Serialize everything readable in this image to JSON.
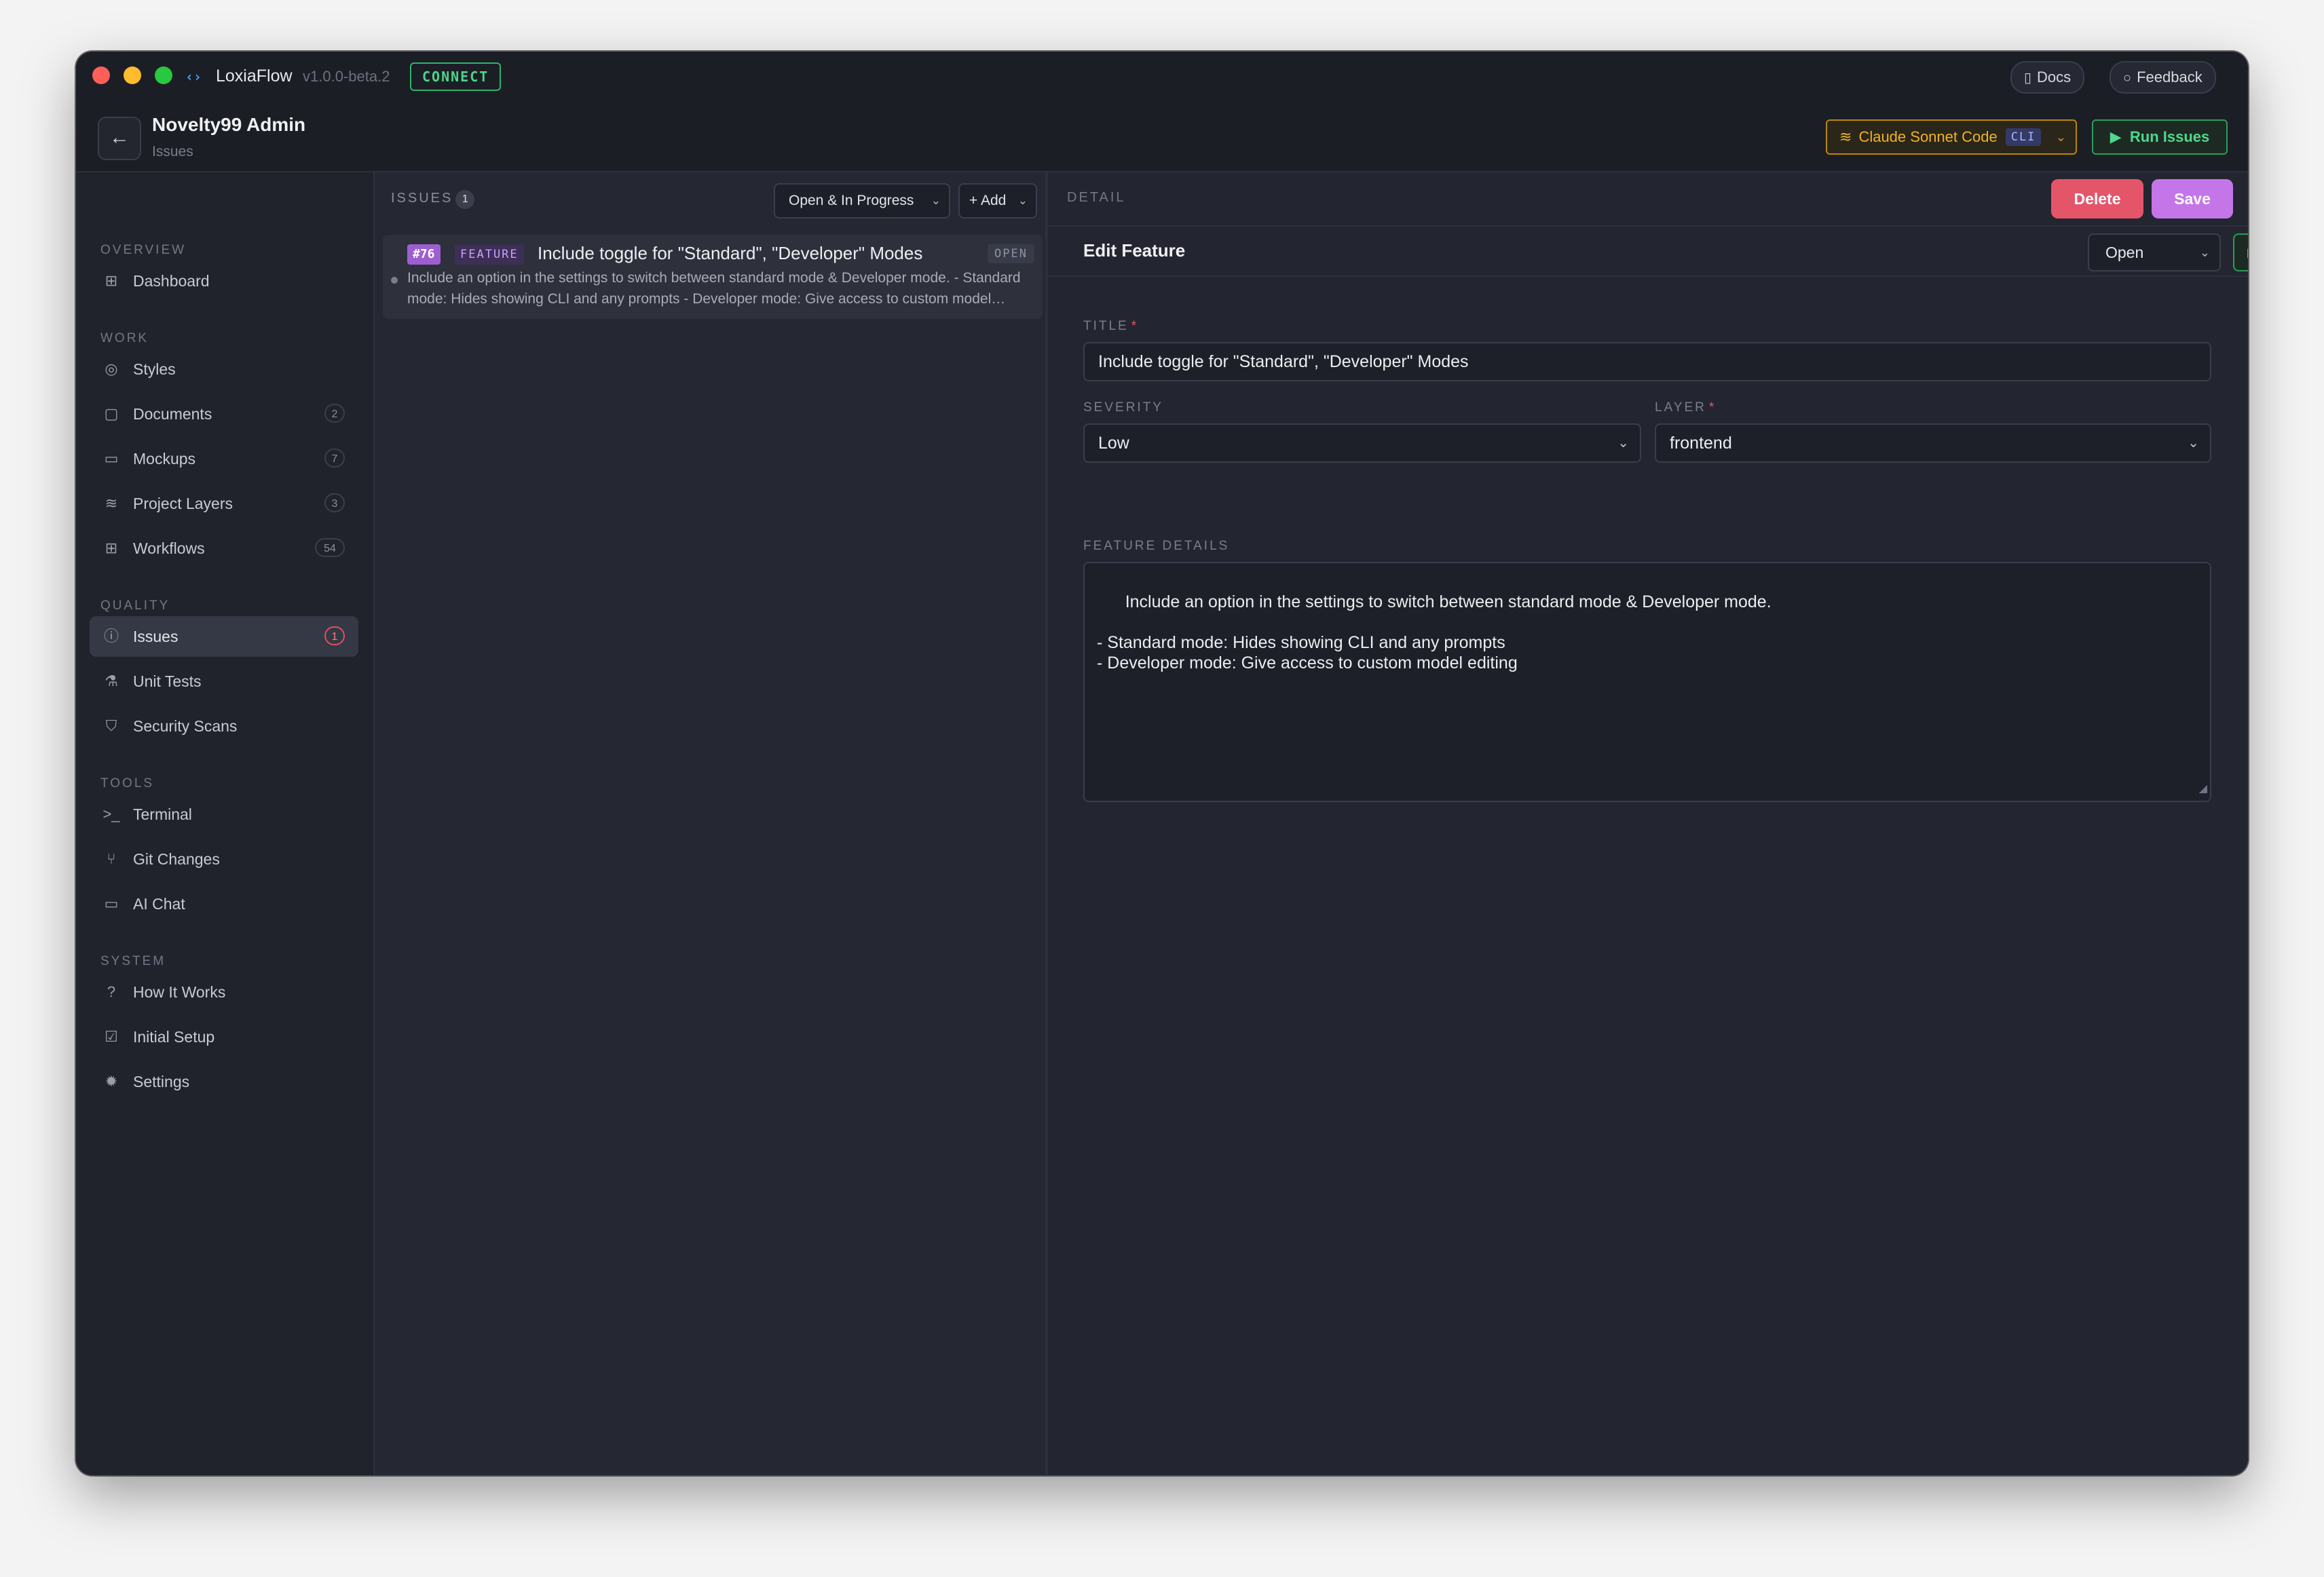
{
  "app": {
    "name": "LoxiaFlow",
    "version": "v1.0.0-beta.2",
    "connect_label": "CONNECT",
    "docs_label": "Docs",
    "feedback_label": "Feedback"
  },
  "project": {
    "name": "Novelty99 Admin",
    "subtitle": "Issues"
  },
  "toolbar": {
    "model_label": "Claude Sonnet Code",
    "model_tag": "CLI",
    "run_label": "Run Issues"
  },
  "sidebar": {
    "sections": {
      "overview": "OVERVIEW",
      "work": "WORK",
      "quality": "QUALITY",
      "tools": "TOOLS",
      "system": "SYSTEM"
    },
    "items": {
      "dashboard": {
        "label": "Dashboard"
      },
      "styles": {
        "label": "Styles"
      },
      "documents": {
        "label": "Documents",
        "count": "2"
      },
      "mockups": {
        "label": "Mockups",
        "count": "7"
      },
      "project_layers": {
        "label": "Project Layers",
        "count": "3"
      },
      "workflows": {
        "label": "Workflows",
        "count": "54"
      },
      "issues": {
        "label": "Issues",
        "count": "1"
      },
      "unit_tests": {
        "label": "Unit Tests"
      },
      "security_scans": {
        "label": "Security Scans"
      },
      "terminal": {
        "label": "Terminal"
      },
      "git_changes": {
        "label": "Git Changes"
      },
      "ai_chat": {
        "label": "AI Chat"
      },
      "how_it_works": {
        "label": "How It Works"
      },
      "initial_setup": {
        "label": "Initial Setup"
      },
      "settings": {
        "label": "Settings"
      }
    },
    "active": "issues"
  },
  "issues_panel": {
    "title": "ISSUES",
    "count": "1",
    "filter_value": "Open & In Progress",
    "add_label": "+ Add",
    "items": [
      {
        "number": "#76",
        "type": "FEATURE",
        "title": "Include toggle for \"Standard\", \"Developer\" Modes",
        "status": "OPEN",
        "description": "Include an option in the settings to switch between standard mode & Developer mode. - Standard mode: Hides showing CLI and any prompts - Developer mode: Give access to custom model editing"
      }
    ]
  },
  "detail": {
    "label": "DETAIL",
    "delete_label": "Delete",
    "save_label": "Save",
    "heading": "Edit Feature",
    "status_value": "Open",
    "title_label": "TITLE",
    "title_value": "Include toggle for \"Standard\", \"Developer\" Modes",
    "severity_label": "SEVERITY",
    "severity_value": "Low",
    "layer_label": "LAYER",
    "layer_value": "frontend",
    "details_label": "FEATURE DETAILS",
    "details_value": "Include an option in the settings to switch between standard mode & Developer mode.\n\n- Standard mode: Hides showing CLI and any prompts\n- Developer mode: Give access to custom model editing",
    "required_mark": "*"
  },
  "colors": {
    "window_bg": "#23252f",
    "accent_purple": "#c475e8",
    "danger": "#e5556a",
    "success": "#4ed98c",
    "warning": "#f0b324"
  }
}
